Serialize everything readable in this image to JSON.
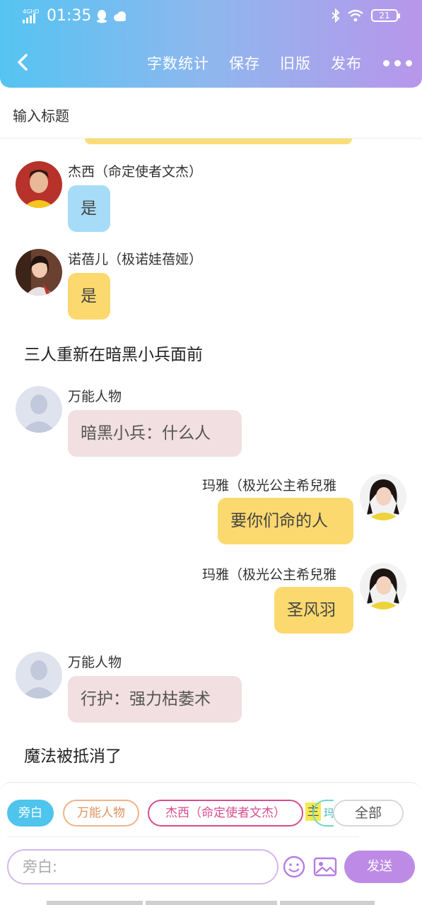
{
  "status_bar": {
    "network": "4GHD",
    "time": "01:35",
    "battery": "21"
  },
  "toolbar": {
    "word_count": "字数统计",
    "save": "保存",
    "old_version": "旧版",
    "publish": "发布"
  },
  "title_placeholder": "输入标题",
  "messages": [
    {
      "name": "杰西（命定使者文杰）",
      "text": "是"
    },
    {
      "name": "诺蓓儿（极诺娃蓓娅）",
      "text": "是"
    },
    {
      "narration": "三人重新在暗黑小兵面前"
    },
    {
      "name": "万能人物",
      "text": "暗黑小兵：什么人"
    },
    {
      "name": "玛雅（极光公主希兒雅",
      "text": "要你们命的人"
    },
    {
      "name": "玛雅（极光公主希兒雅",
      "text": "圣风羽"
    },
    {
      "name": "万能人物",
      "text": "行护：强力枯萎术"
    },
    {
      "narration": "魔法被抵消了"
    }
  ],
  "role_chips": [
    "旁白",
    "万能人物",
    "杰西（命定使者文杰）",
    "主",
    "玛",
    "全部"
  ],
  "composer": {
    "placeholder": "旁白:",
    "send": "发送"
  },
  "colors": {
    "blue_bubble": "#a7dcf8",
    "yellow_bubble": "#fcd96f",
    "pink_bubble": "#f1dfe1",
    "send": "#bd8be6"
  }
}
